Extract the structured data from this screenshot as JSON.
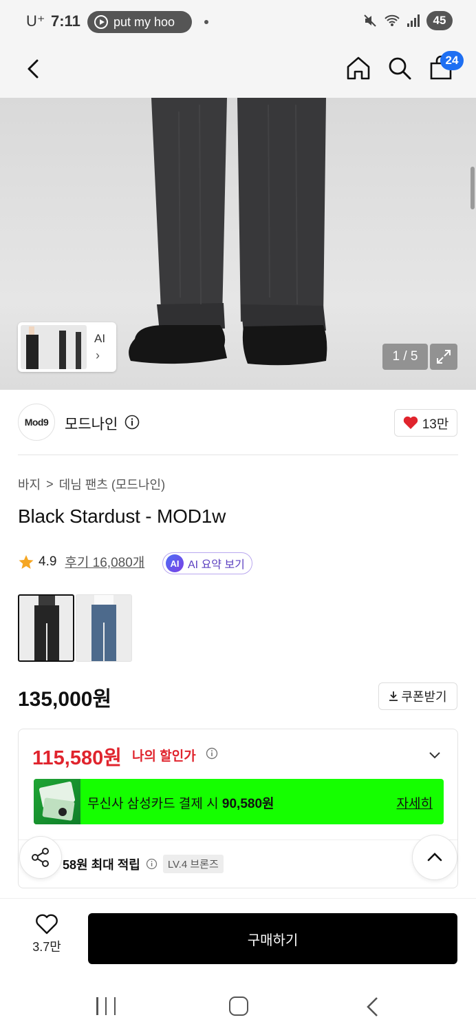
{
  "status_bar": {
    "carrier": "U⁺",
    "time": "7:11",
    "media_pill": "put my hoo",
    "battery": "45"
  },
  "top_nav": {
    "cart_count": "24"
  },
  "gallery": {
    "thumb_label": "AI",
    "thumb_arrow": "›",
    "counter": "1 / 5"
  },
  "brand": {
    "logo_text": "Mod9",
    "name": "모드나인",
    "likes": "13만"
  },
  "breadcrumb": {
    "items": [
      "바지",
      "데님 팬츠 (모드나인)"
    ],
    "separator": ">"
  },
  "product": {
    "title": "Black Stardust - MOD1w",
    "rating": "4.9",
    "reviews": "후기 16,080개",
    "ai_badge": "AI",
    "ai_summary": "AI 요약 보기",
    "price": "135,000원",
    "coupon_label": "쿠폰받기"
  },
  "discount": {
    "my_price": "115,580원",
    "my_price_label": "나의 할인가",
    "card_text_prefix": "무신사 삼성카드 결제 시 ",
    "card_text_amount": "90,580원",
    "card_detail": "자세히",
    "points_text": "58원 최대 적립",
    "level_badge": "LV.4 브론즈"
  },
  "bottom_bar": {
    "wish_count": "3.7만",
    "buy_label": "구매하기"
  },
  "colors": {
    "accent_red": "#e0242d",
    "card_banner": "#15ff00",
    "cart_badge": "#1e6ff2",
    "ai_purple": "#5a3fc0"
  },
  "icons": [
    "back-icon",
    "home-icon",
    "search-icon",
    "cart-icon",
    "expand-icon",
    "info-icon",
    "heart-icon",
    "star-icon",
    "download-icon",
    "chevron-down-icon",
    "share-icon",
    "chevron-up-icon"
  ]
}
